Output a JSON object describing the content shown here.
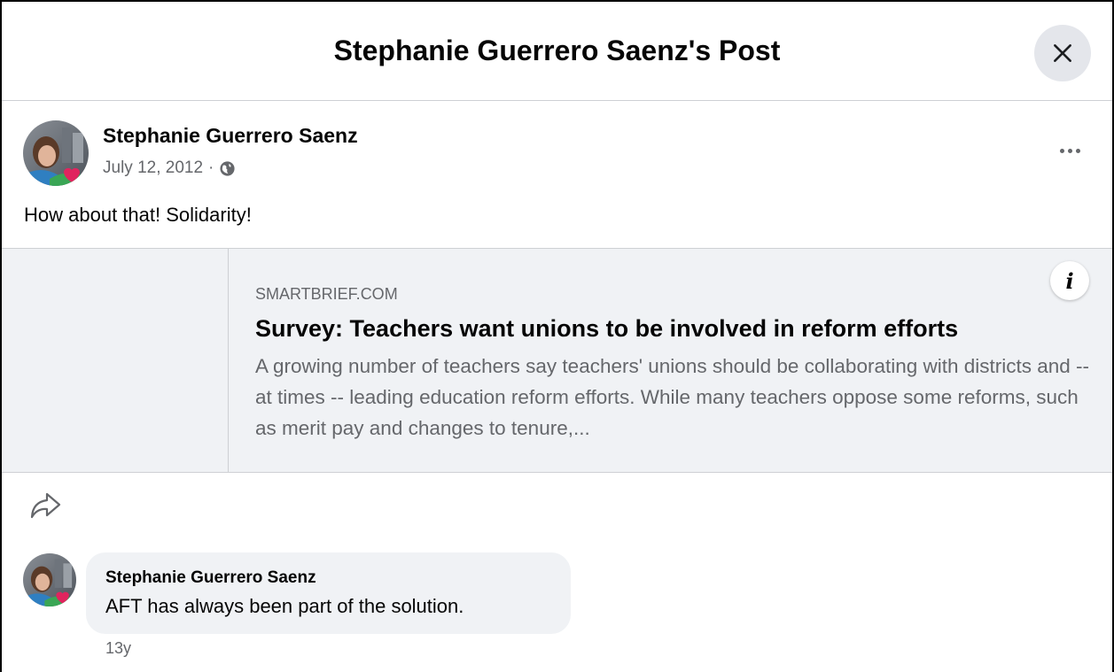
{
  "dialog": {
    "title": "Stephanie Guerrero Saenz's Post",
    "close_icon": "close-icon"
  },
  "post": {
    "author": "Stephanie Guerrero Saenz",
    "date": "July 12, 2012",
    "separator": "·",
    "privacy_icon": "globe-icon",
    "more_icon": "more-options-icon",
    "text": "How about that! Solidarity!"
  },
  "link_preview": {
    "domain": "SMARTBRIEF.COM",
    "title": "Survey: Teachers want unions to be involved in reform efforts",
    "description": "A growing number of teachers say teachers' unions should be collaborating with districts and -- at times -- leading education reform efforts. While many teachers oppose some reforms, such as merit pay and changes to tenure,...",
    "info_label": "i"
  },
  "actions": {
    "share_icon": "share-icon"
  },
  "comment": {
    "author": "Stephanie Guerrero Saenz",
    "text": "AFT has always been part of the solution.",
    "age": "13y"
  },
  "colors": {
    "secondary_text": "#65676b",
    "card_background": "#f0f2f5",
    "divider": "#ced0d4",
    "close_button_bg": "#e4e6eb"
  }
}
